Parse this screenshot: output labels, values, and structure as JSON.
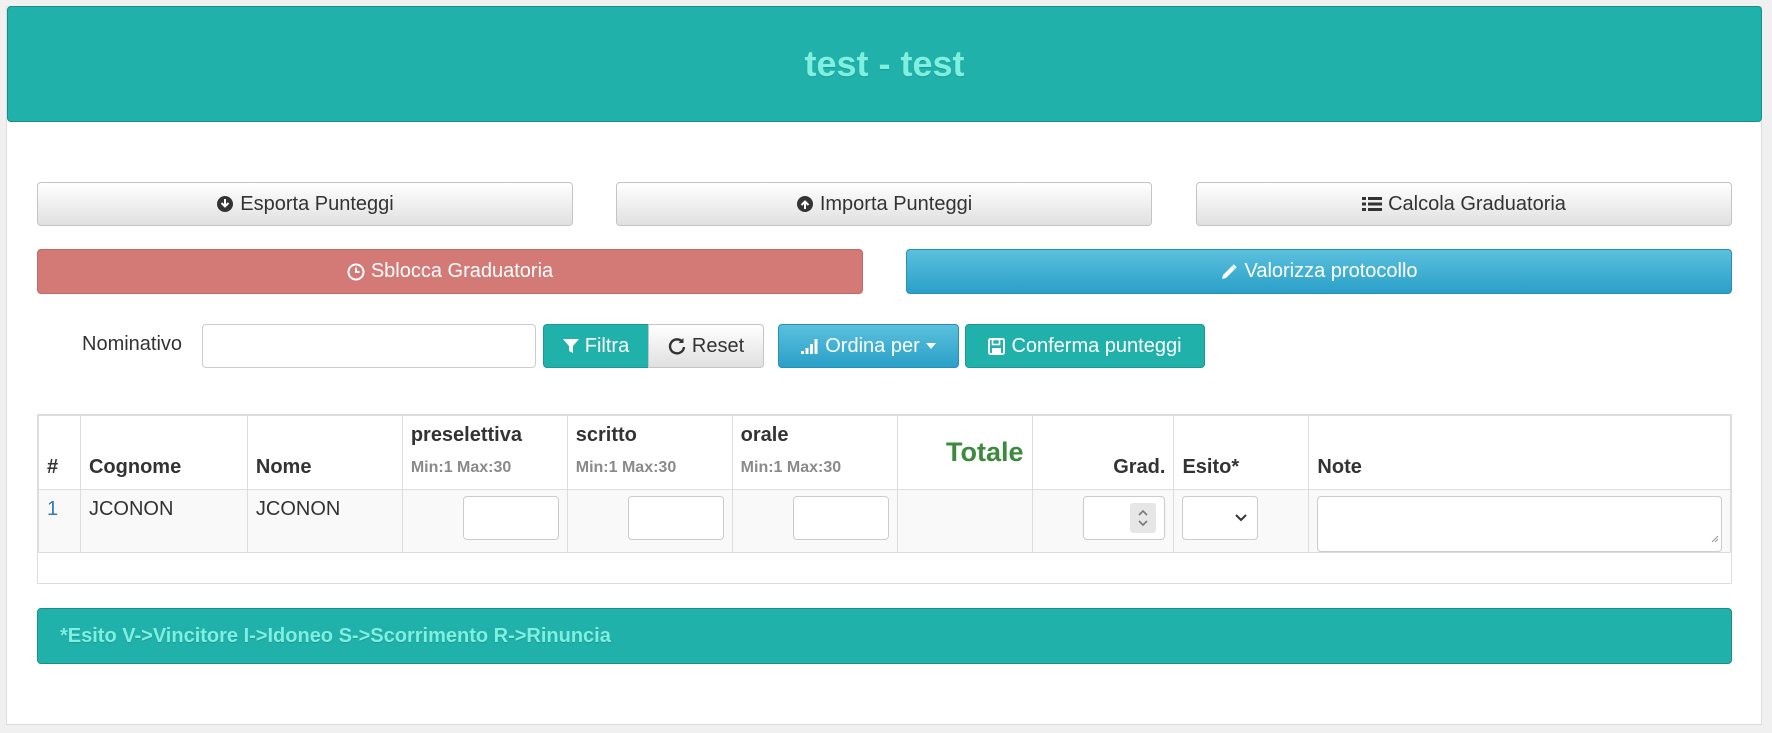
{
  "header": {
    "title": "test - test"
  },
  "actions": {
    "esporta": "Esporta Punteggi",
    "importa": "Importa Punteggi",
    "calcola": "Calcola Graduatoria",
    "sblocca": "Sblocca Graduatoria",
    "valorizza": "Valorizza protocollo"
  },
  "filter": {
    "label": "Nominativo",
    "value": "",
    "filtra": "Filtra",
    "reset": "Reset",
    "ordina": "Ordina per",
    "conferma": "Conferma punteggi"
  },
  "table": {
    "headers": {
      "idx": "#",
      "cognome": "Cognome",
      "nome": "Nome",
      "preselettiva": "preselettiva",
      "preselettiva_range": "Min:1 Max:30",
      "scritto": "scritto",
      "scritto_range": "Min:1 Max:30",
      "orale": "orale",
      "orale_range": "Min:1 Max:30",
      "totale": "Totale",
      "grad": "Grad.",
      "esito": "Esito*",
      "note": "Note"
    },
    "rows": [
      {
        "idx": "1",
        "cognome": "JCONON",
        "nome": "JCONON"
      }
    ]
  },
  "legend": {
    "text": "*Esito V->Vincitore I->Idoneo S->Scorrimento R->Rinuncia"
  },
  "colors": {
    "teal": "#20b2aa",
    "danger": "#d47a76",
    "info": "#2aa0c8",
    "totale": "#3c8a3c"
  }
}
